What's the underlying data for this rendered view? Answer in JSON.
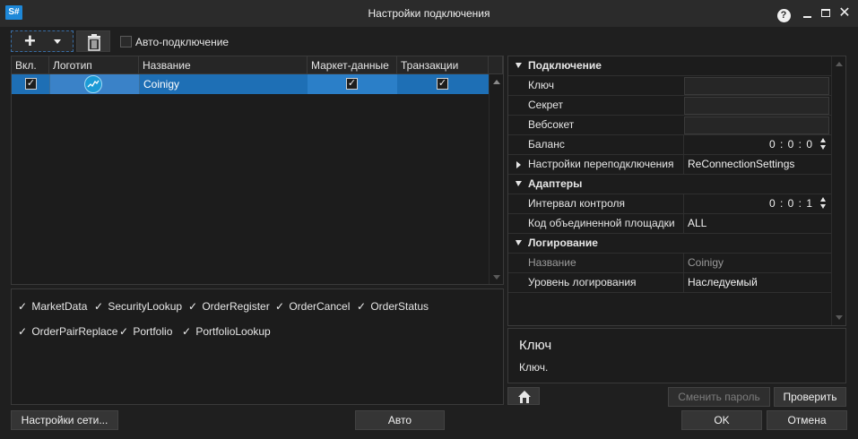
{
  "window": {
    "app_logo": "S#",
    "title": "Настройки подключения",
    "icons": [
      "help-icon",
      "minimize-icon",
      "maximize-icon",
      "close-icon"
    ]
  },
  "toolbar": {
    "add_icon": "plus-icon",
    "delete_icon": "trash-icon",
    "auto_connect_label": "Авто-подключение",
    "auto_connect_checked": false
  },
  "grid": {
    "columns": [
      "Вкл.",
      "Логотип",
      "Название",
      "Маркет-данные",
      "Транзакции"
    ],
    "rows": [
      {
        "enabled": true,
        "logo": "coinigy-logo-icon",
        "name": "Coinigy",
        "market_data": true,
        "transactions": true
      }
    ]
  },
  "message_types": [
    "MarketData",
    "SecurityLookup",
    "OrderRegister",
    "OrderCancel",
    "OrderStatus",
    "OrderPairReplace",
    "Portfolio",
    "PortfolioLookup"
  ],
  "properties": {
    "connection": {
      "category": "Подключение",
      "key_label": "Ключ",
      "key_value": "",
      "secret_label": "Секрет",
      "secret_value": "",
      "websocket_label": "Вебсокет",
      "websocket_value": "",
      "balance_label": "Баланс",
      "balance_value": "0 : 0 : 0",
      "reconnect_label": "Настройки переподключения",
      "reconnect_value": "ReConnectionSettings"
    },
    "adapters": {
      "category": "Адаптеры",
      "interval_label": "Интервал контроля",
      "interval_value": "0 : 0 : 1",
      "board_label": "Код объединенной площадки",
      "board_value": "ALL"
    },
    "logging": {
      "category": "Логирование",
      "name_label": "Название",
      "name_value": "Coinigy",
      "level_label": "Уровень логирования",
      "level_value": "Наследуемый"
    }
  },
  "description": {
    "title": "Ключ",
    "text": "Ключ."
  },
  "buttons": {
    "change_password": "Сменить пароль",
    "check": "Проверить",
    "network_settings": "Настройки сети...",
    "auto": "Авто",
    "ok": "OK",
    "cancel": "Отмена"
  },
  "colors": {
    "accent": "#1e6fb5",
    "background": "#1f1f1f",
    "panel": "#1c1c1c"
  }
}
